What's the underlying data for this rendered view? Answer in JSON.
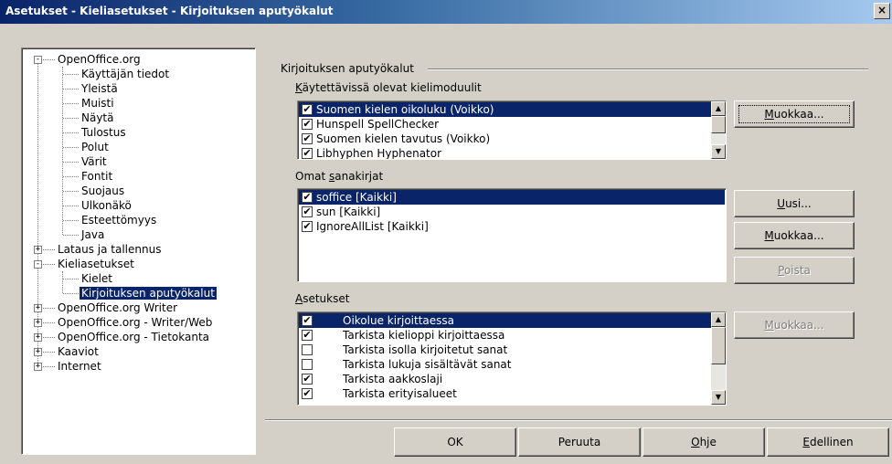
{
  "window": {
    "title": "Asetukset - Kieliasetukset - Kirjoituksen aputyökalut",
    "close_label": "×"
  },
  "tree": {
    "items": [
      {
        "label": "OpenOffice.org",
        "level": 0,
        "toggle": "-"
      },
      {
        "label": "Käyttäjän tiedot",
        "level": 1
      },
      {
        "label": "Yleistä",
        "level": 1
      },
      {
        "label": "Muisti",
        "level": 1
      },
      {
        "label": "Näytä",
        "level": 1
      },
      {
        "label": "Tulostus",
        "level": 1
      },
      {
        "label": "Polut",
        "level": 1
      },
      {
        "label": "Värit",
        "level": 1
      },
      {
        "label": "Fontit",
        "level": 1
      },
      {
        "label": "Suojaus",
        "level": 1
      },
      {
        "label": "Ulkonäkö",
        "level": 1
      },
      {
        "label": "Esteettömyys",
        "level": 1
      },
      {
        "label": "Java",
        "level": 1
      },
      {
        "label": "Lataus ja tallennus",
        "level": 0,
        "toggle": "+"
      },
      {
        "label": "Kieliasetukset",
        "level": 0,
        "toggle": "-"
      },
      {
        "label": "Kielet",
        "level": 1
      },
      {
        "label": "Kirjoituksen aputyökalut",
        "level": 1,
        "selected": true
      },
      {
        "label": "OpenOffice.org Writer",
        "level": 0,
        "toggle": "+"
      },
      {
        "label": "OpenOffice.org - Writer/Web",
        "level": 0,
        "toggle": "+"
      },
      {
        "label": "OpenOffice.org - Tietokanta",
        "level": 0,
        "toggle": "+"
      },
      {
        "label": "Kaaviot",
        "level": 0,
        "toggle": "+"
      },
      {
        "label": "Internet",
        "level": 0,
        "toggle": "+"
      }
    ]
  },
  "panel": {
    "group_title": "Kirjoituksen aputyökalut",
    "modules": {
      "label_pre": "",
      "label_key": "K",
      "label_post": "äytettävissä olevat kielimoduulit",
      "items": [
        {
          "label": "Suomen kielen oikoluku (Voikko)",
          "checked": true,
          "selected": true
        },
        {
          "label": "Hunspell SpellChecker",
          "checked": true
        },
        {
          "label": "Suomen kielen tavutus (Voikko)",
          "checked": true
        },
        {
          "label": "Libhyphen Hyphenator",
          "checked": true
        }
      ],
      "edit_button": {
        "pre": "",
        "key": "M",
        "post": "uokkaa..."
      }
    },
    "dictionaries": {
      "label_pre": "Omat ",
      "label_key": "s",
      "label_post": "anakirjat",
      "items": [
        {
          "label": "soffice [Kaikki]",
          "checked": true,
          "selected": true
        },
        {
          "label": "sun [Kaikki]",
          "checked": true
        },
        {
          "label": "IgnoreAllList [Kaikki]",
          "checked": true
        }
      ],
      "new_button": {
        "pre": "",
        "key": "U",
        "post": "usi..."
      },
      "edit_button": {
        "pre": "",
        "key": "M",
        "post": "uokkaa..."
      },
      "delete_button": {
        "pre": "",
        "key": "P",
        "post": "oista"
      }
    },
    "options": {
      "label_pre": "",
      "label_key": "A",
      "label_post": "setukset",
      "items": [
        {
          "label": "Oikolue kirjoittaessa",
          "checked": true,
          "selected": true
        },
        {
          "label": "Tarkista kielioppi kirjoittaessa",
          "checked": true
        },
        {
          "label": "Tarkista isolla kirjoitetut sanat",
          "checked": false
        },
        {
          "label": "Tarkista lukuja sisältävät sanat",
          "checked": false
        },
        {
          "label": "Tarkista aakkoslaji",
          "checked": true
        },
        {
          "label": "Tarkista erityisalueet",
          "checked": true
        }
      ],
      "edit_button": {
        "pre": "",
        "key": "M",
        "post": "uokkaa..."
      }
    }
  },
  "footer": {
    "ok": {
      "pre": "OK",
      "key": "",
      "post": ""
    },
    "cancel": {
      "pre": "Peruuta",
      "key": "",
      "post": ""
    },
    "help": {
      "pre": "",
      "key": "O",
      "post": "hje"
    },
    "back": {
      "pre": "",
      "key": "E",
      "post": "dellinen"
    }
  },
  "icons": {
    "check": "✔",
    "scroll_up": "▲",
    "scroll_down": "▼"
  }
}
